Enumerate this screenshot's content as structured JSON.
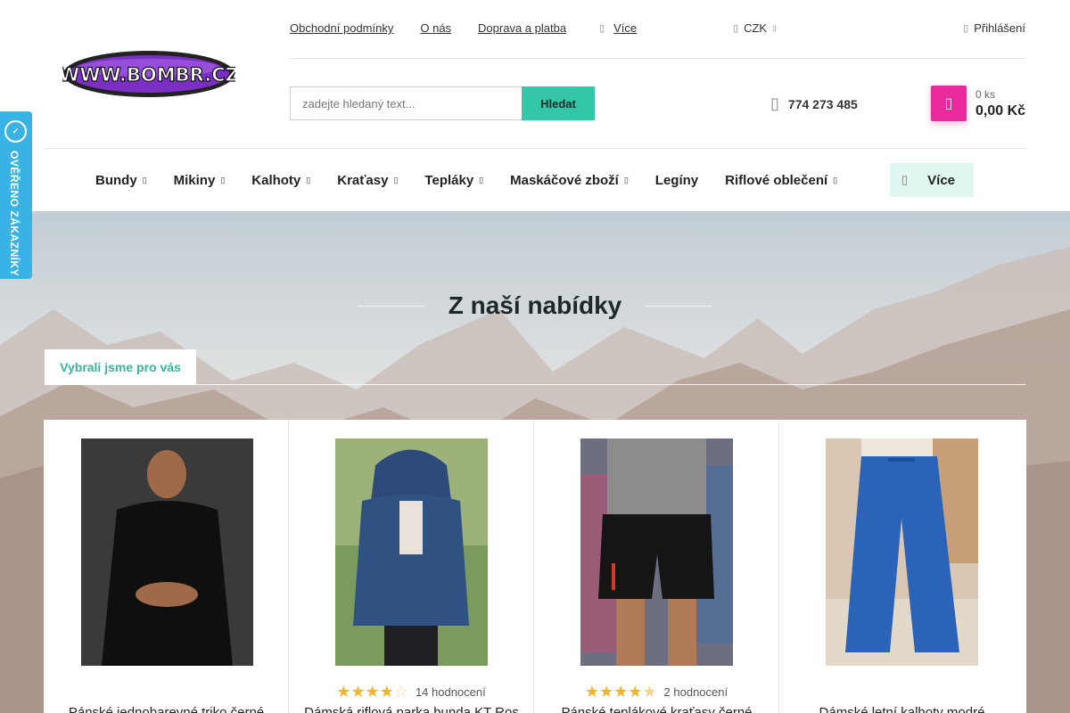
{
  "logo": {
    "text": "WWW.BOMBR.CZ"
  },
  "top_links": [
    "Obchodní podmínky",
    "O nás",
    "Doprava a platba"
  ],
  "more_link": {
    "label": "Více"
  },
  "currency": {
    "label": "CZK"
  },
  "login": {
    "label": "Přihlášení"
  },
  "search": {
    "placeholder": "zadejte hledaný text...",
    "button_label": "Hledat"
  },
  "phone": "774 273 485",
  "cart": {
    "count": "0 ks",
    "price": "0,00 Kč"
  },
  "nav": {
    "items": [
      {
        "label": "Bundy",
        "dropdown": true
      },
      {
        "label": "Mikiny",
        "dropdown": true
      },
      {
        "label": "Kalhoty",
        "dropdown": true
      },
      {
        "label": "Kraťasy",
        "dropdown": true
      },
      {
        "label": "Tepláky",
        "dropdown": true
      },
      {
        "label": "Maskáčové zboží",
        "dropdown": true
      },
      {
        "label": "Legíny",
        "dropdown": false
      },
      {
        "label": "Riflové oblečení",
        "dropdown": true
      }
    ],
    "more_label": "Více"
  },
  "section": {
    "title": "Z naší nabídky",
    "tab_label": "Vybrali jsme pro vás"
  },
  "products": [
    {
      "name": "Pánské jednobarevné triko černé",
      "rating": null,
      "reviews": ""
    },
    {
      "name": "Dámská riflová parka bunda KT Ros",
      "rating": 4,
      "reviews": "14 hodnocení"
    },
    {
      "name": "Pánské teplákové kraťasy černé",
      "rating": 4.5,
      "reviews": "2 hodnocení"
    },
    {
      "name": "Dámské letní kalhoty modré",
      "rating": null,
      "reviews": ""
    }
  ],
  "badge": {
    "text": "OVĚŘENO ZÁKAZNÍKY",
    "icon_text": "HEUREKA"
  },
  "colors": {
    "accent": "#33c7a7",
    "cart": "#ea2b9c",
    "badge": "#38b3e5",
    "star": "#f0b52b"
  }
}
